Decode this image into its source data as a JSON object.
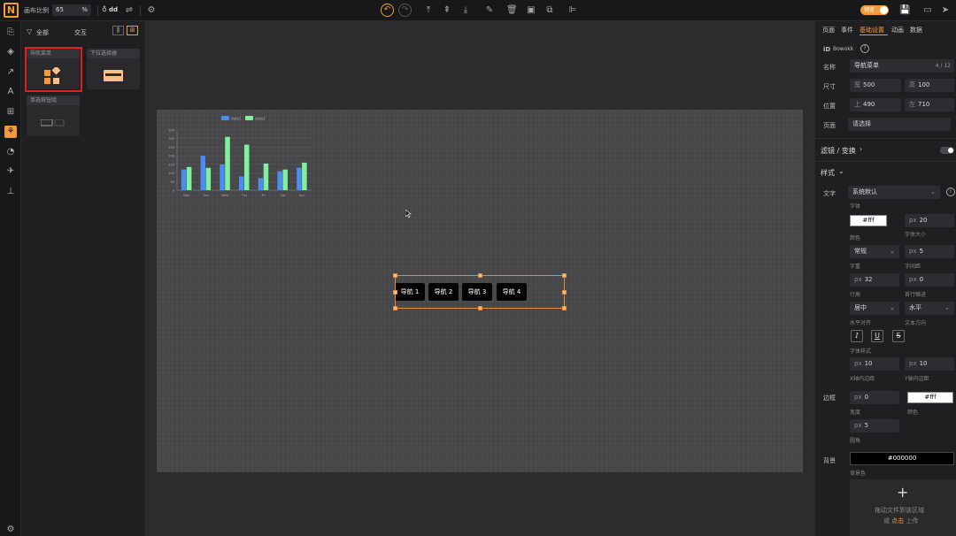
{
  "topbar": {
    "zoom_label": "画布比例",
    "zoom_value": "65",
    "zoom_unit": "%",
    "project_name": "dd",
    "toggle_label": "预览"
  },
  "panel": {
    "filter_all": "全部",
    "tab_interact": "交互",
    "components": [
      {
        "label": "导航菜单"
      },
      {
        "label": "下拉选择器"
      },
      {
        "label": "单选按钮组"
      }
    ]
  },
  "chart_data": {
    "type": "bar",
    "categories": [
      "Mon",
      "Tue",
      "Wed",
      "Thu",
      "Fri",
      "Sat",
      "Sun"
    ],
    "series": [
      {
        "name": "data1",
        "values": [
          120,
          200,
          150,
          80,
          70,
          110,
          130
        ]
      },
      {
        "name": "data2",
        "values": [
          135,
          130,
          310,
          265,
          155,
          120,
          160
        ]
      }
    ],
    "y_ticks": [
      "350",
      "300",
      "250",
      "200",
      "150",
      "100",
      "50",
      "0"
    ],
    "ylim": [
      0,
      350
    ],
    "legend": "top",
    "grid": true
  },
  "canvas": {
    "nav_items": [
      "导航 1",
      "导航 2",
      "导航 3",
      "导航 4"
    ],
    "colors": {
      "selection": "#e08a3a",
      "nav_bg": "#000000"
    }
  },
  "rpanel": {
    "tabs": [
      "页面",
      "事件",
      "基础设置",
      "动画",
      "数据"
    ],
    "active_tab": "基础设置",
    "id_label": "iD",
    "id_value": "Bowokk",
    "name_label": "名称",
    "name_value": "导航菜单",
    "name_count": "4 / 12",
    "size_label": "尺寸",
    "w_prefix": "宽",
    "w_value": "500",
    "h_prefix": "高",
    "h_value": "100",
    "pos_label": "位置",
    "top_prefix": "上",
    "top_value": "490",
    "left_prefix": "左",
    "left_value": "710",
    "page_label": "页面",
    "page_placeholder": "请选择",
    "filter_label": "滤镜 / 变换",
    "style_label": "样式",
    "text_label": "文字",
    "font_value": "系统默认",
    "font_sub": "字体",
    "color_value": "#fff",
    "color_sub": "颜色",
    "size_unit": "px",
    "fontsize_value": "20",
    "fontsize_sub": "字体大小",
    "weight_value": "常规",
    "weight_sub": "字重",
    "spacing_value": "5",
    "spacing_sub": "字间距",
    "lineh_value": "32",
    "lineh_sub": "行高",
    "indent_value": "0",
    "indent_sub": "首行缩进",
    "align_value": "居中",
    "align_sub": "水平对齐",
    "dir_value": "水平",
    "dir_sub": "文本方向",
    "fontstyle_sub": "字体样式",
    "xpad_value": "10",
    "xpad_sub": "X轴内边距",
    "ypad_value": "10",
    "ypad_sub": "Y轴内边距",
    "border_label": "边框",
    "bw_value": "0",
    "bw_sub": "宽度",
    "bcolor_value": "#fff",
    "bcolor_sub": "颜色",
    "radius_value": "5",
    "radius_sub": "圆角",
    "bg_label": "背景",
    "bg_value": "#000000",
    "bg_sub": "背景色",
    "upload_line1": "拖动文件到该区域",
    "upload_line2a": "或 ",
    "upload_link": "点击",
    "upload_line2b": " 上传"
  },
  "colors": {
    "accent": "#f39a3d",
    "brand": "#f0a030"
  }
}
